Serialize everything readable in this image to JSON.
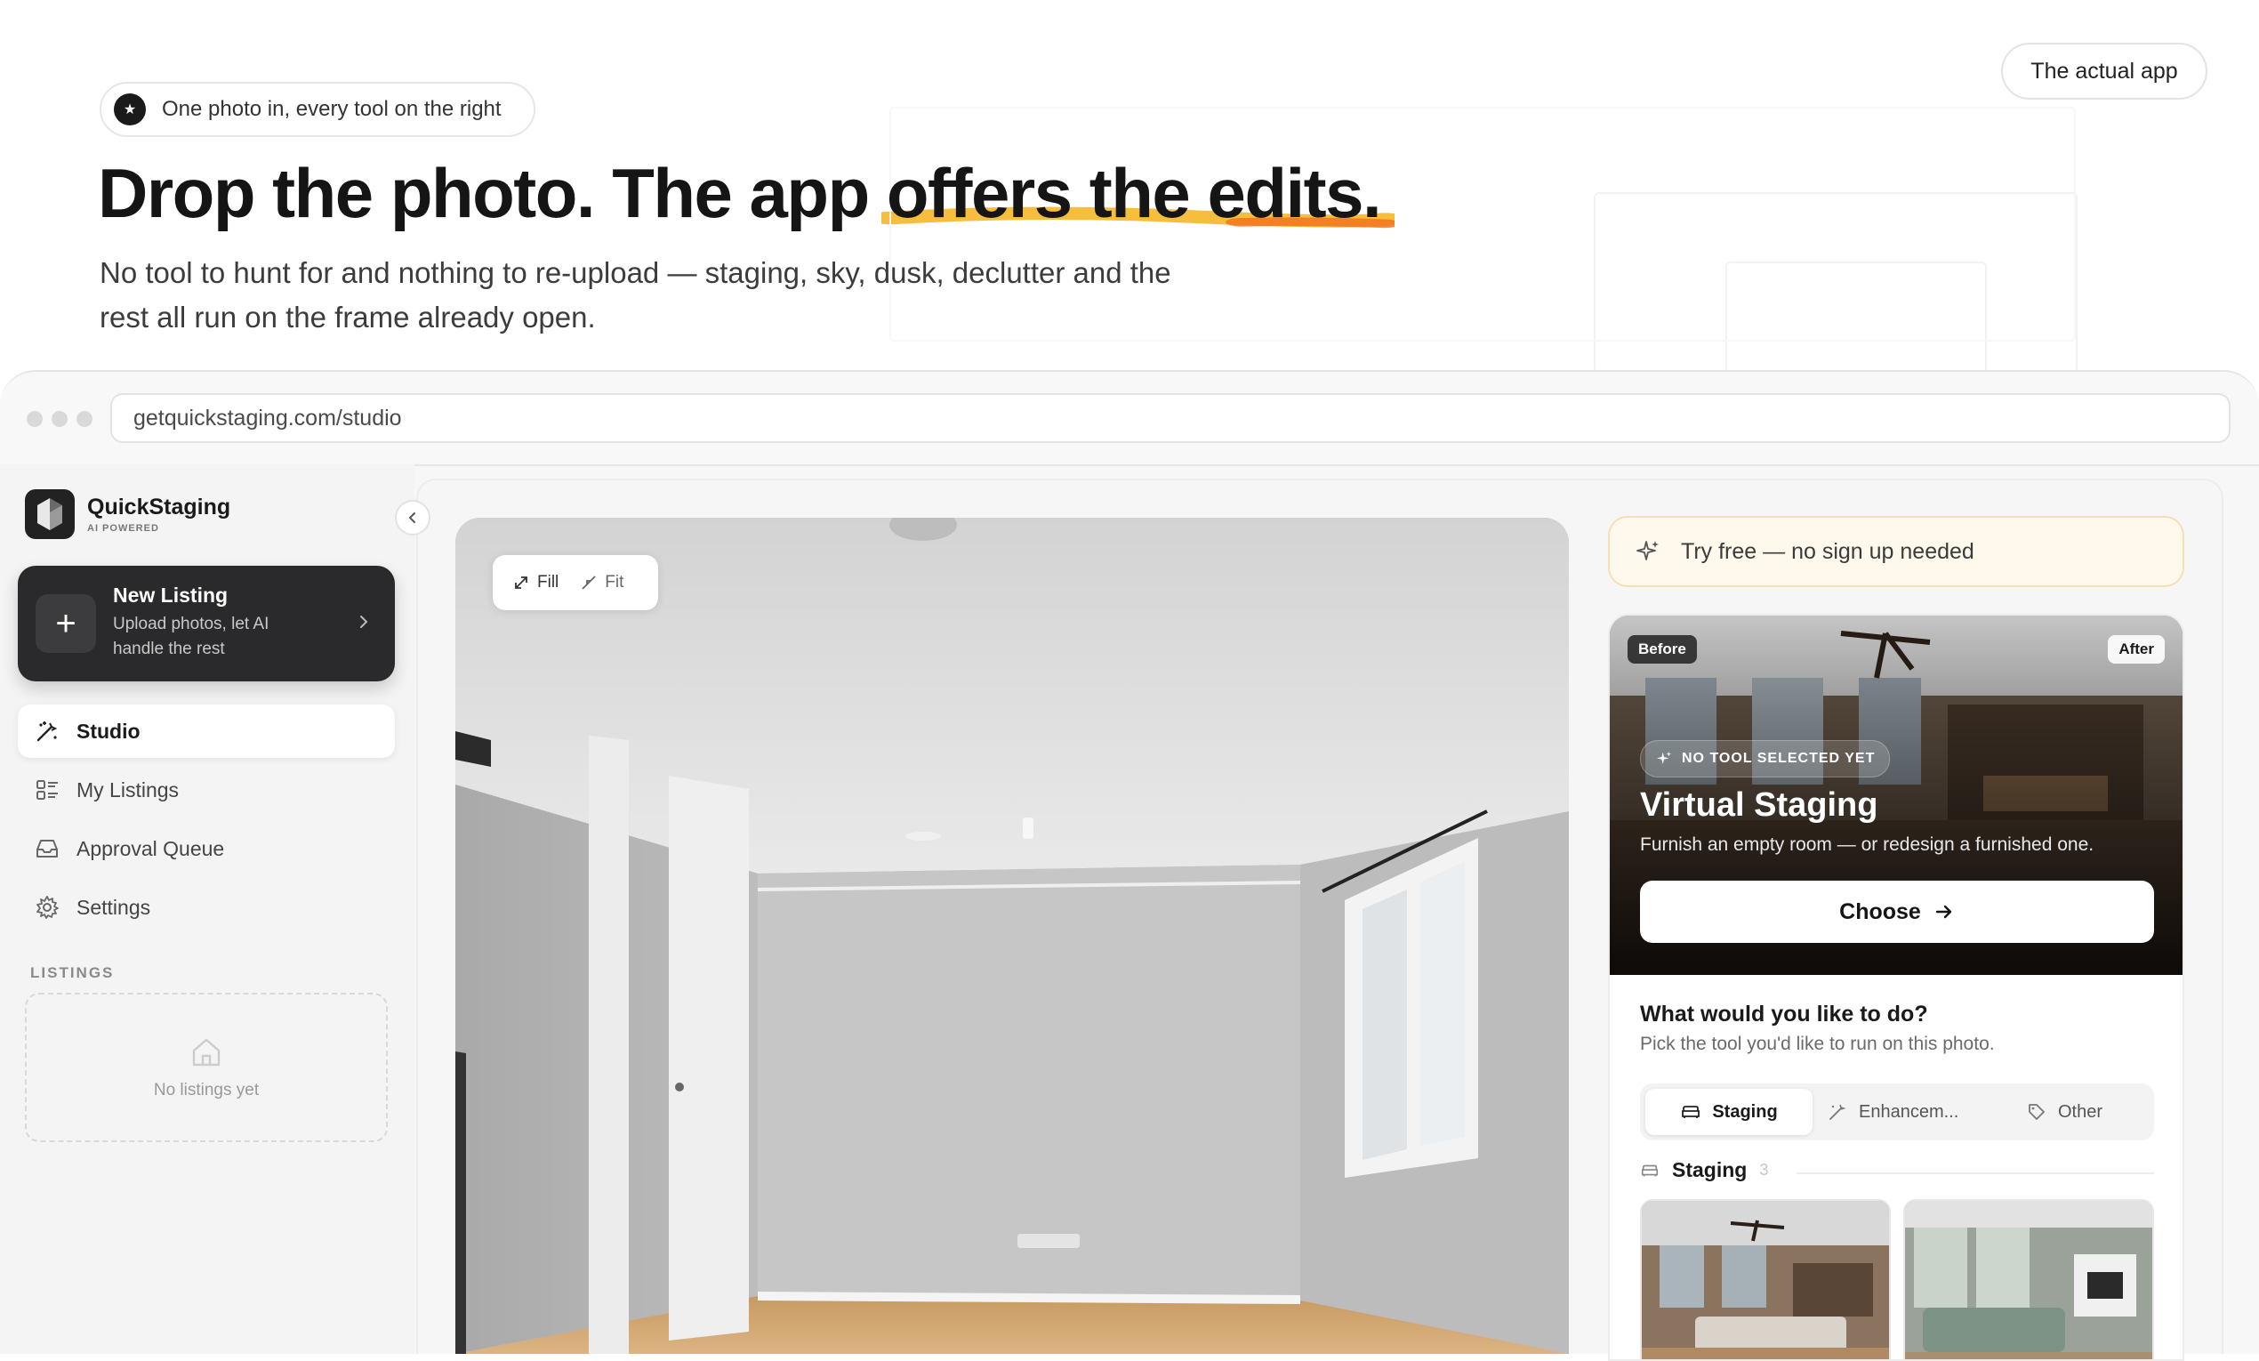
{
  "hero": {
    "pill_text": "One photo in, every tool on the right",
    "pill_icon": "star-icon",
    "title_plain": "Drop the photo. The app ",
    "title_highlight": "offers the edits.",
    "subtitle": "No tool to hunt for and nothing to re-upload — staging, sky, dusk, declutter and the rest all run on the frame already open.",
    "actual_app_label": "The actual app",
    "highlight_color": "#f6b21a"
  },
  "browser": {
    "url": "getquickstaging.com/studio"
  },
  "sidebar": {
    "brand_name": "QuickStaging",
    "brand_tagline": "AI POWERED",
    "new_listing": {
      "title": "New Listing",
      "description": "Upload photos, let AI handle the rest"
    },
    "nav": [
      {
        "label": "Studio",
        "icon": "magic-wand-icon",
        "active": true
      },
      {
        "label": "My Listings",
        "icon": "list-icon",
        "active": false
      },
      {
        "label": "Approval Queue",
        "icon": "inbox-icon",
        "active": false
      },
      {
        "label": "Settings",
        "icon": "gear-icon",
        "active": false
      }
    ],
    "listings_label": "LISTINGS",
    "empty_listings": "No listings yet"
  },
  "canvas": {
    "fill_label": "Fill",
    "fit_label": "Fit"
  },
  "panel": {
    "try_free": "Try free — no sign up needed",
    "before_tag": "Before",
    "after_tag": "After",
    "no_tool_badge": "NO TOOL SELECTED YET",
    "tool_title": "Virtual Staging",
    "tool_desc": "Furnish an empty room — or redesign a furnished one.",
    "choose_label": "Choose",
    "question_title": "What would you like to do?",
    "question_sub": "Pick the tool you'd like to run on this photo.",
    "tabs": [
      {
        "label": "Staging",
        "icon": "sofa-icon",
        "active": true
      },
      {
        "label": "Enhancem...",
        "icon": "wand-icon",
        "active": false
      },
      {
        "label": "Other",
        "icon": "tag-icon",
        "active": false
      }
    ],
    "section_title": "Staging",
    "section_count": "3"
  }
}
